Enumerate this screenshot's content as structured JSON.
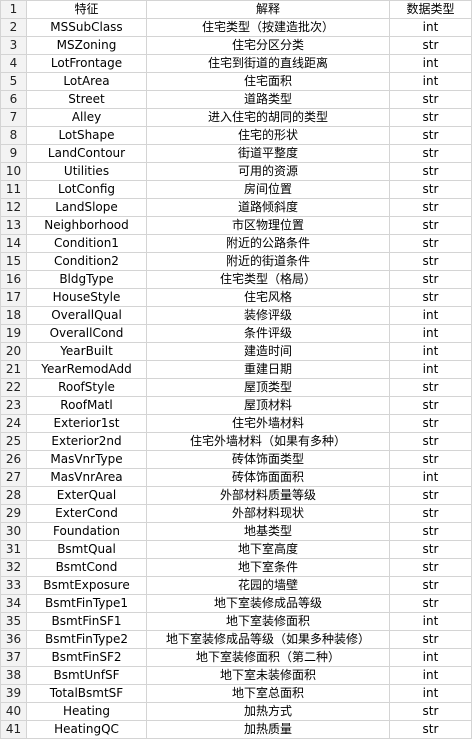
{
  "sheet": {
    "header": {
      "row": "1",
      "feature": "特征",
      "description": "解释",
      "type": "数据类型"
    },
    "rows": [
      {
        "row": "2",
        "feature": "MSSubClass",
        "description": "住宅类型（按建造批次）",
        "type": "int"
      },
      {
        "row": "3",
        "feature": "MSZoning",
        "description": "住宅分区分类",
        "type": "str"
      },
      {
        "row": "4",
        "feature": "LotFrontage",
        "description": "住宅到街道的直线距离",
        "type": "int"
      },
      {
        "row": "5",
        "feature": "LotArea",
        "description": "住宅面积",
        "type": "int"
      },
      {
        "row": "6",
        "feature": "Street",
        "description": "道路类型",
        "type": "str"
      },
      {
        "row": "7",
        "feature": "Alley",
        "description": "进入住宅的胡同的类型",
        "type": "str"
      },
      {
        "row": "8",
        "feature": "LotShape",
        "description": "住宅的形状",
        "type": "str"
      },
      {
        "row": "9",
        "feature": "LandContour",
        "description": "街道平整度",
        "type": "str"
      },
      {
        "row": "10",
        "feature": "Utilities",
        "description": "可用的资源",
        "type": "str"
      },
      {
        "row": "11",
        "feature": "LotConfig",
        "description": "房间位置",
        "type": "str"
      },
      {
        "row": "12",
        "feature": "LandSlope",
        "description": "道路倾斜度",
        "type": "str"
      },
      {
        "row": "13",
        "feature": "Neighborhood",
        "description": "市区物理位置",
        "type": "str"
      },
      {
        "row": "14",
        "feature": "Condition1",
        "description": "附近的公路条件",
        "type": "str"
      },
      {
        "row": "15",
        "feature": "Condition2",
        "description": "附近的街道条件",
        "type": "str"
      },
      {
        "row": "16",
        "feature": "BldgType",
        "description": "住宅类型（格局）",
        "type": "str"
      },
      {
        "row": "17",
        "feature": "HouseStyle",
        "description": "住宅风格",
        "type": "str"
      },
      {
        "row": "18",
        "feature": "OverallQual",
        "description": "装修评级",
        "type": "int"
      },
      {
        "row": "19",
        "feature": "OverallCond",
        "description": "条件评级",
        "type": "int"
      },
      {
        "row": "20",
        "feature": "YearBuilt",
        "description": "建造时间",
        "type": "int"
      },
      {
        "row": "21",
        "feature": "YearRemodAdd",
        "description": "重建日期",
        "type": "int"
      },
      {
        "row": "22",
        "feature": "RoofStyle",
        "description": "屋顶类型",
        "type": "str"
      },
      {
        "row": "23",
        "feature": "RoofMatl",
        "description": "屋顶材料",
        "type": "str"
      },
      {
        "row": "24",
        "feature": "Exterior1st",
        "description": "住宅外墙材料",
        "type": "str"
      },
      {
        "row": "25",
        "feature": "Exterior2nd",
        "description": "住宅外墙材料（如果有多种）",
        "type": "str"
      },
      {
        "row": "26",
        "feature": "MasVnrType",
        "description": "砖体饰面类型",
        "type": "str"
      },
      {
        "row": "27",
        "feature": "MasVnrArea",
        "description": "砖体饰面面积",
        "type": "int"
      },
      {
        "row": "28",
        "feature": "ExterQual",
        "description": "外部材料质量等级",
        "type": "str"
      },
      {
        "row": "29",
        "feature": "ExterCond",
        "description": "外部材料现状",
        "type": "str"
      },
      {
        "row": "30",
        "feature": "Foundation",
        "description": "地基类型",
        "type": "str"
      },
      {
        "row": "31",
        "feature": "BsmtQual",
        "description": "地下室高度",
        "type": "str"
      },
      {
        "row": "32",
        "feature": "BsmtCond",
        "description": "地下室条件",
        "type": "str"
      },
      {
        "row": "33",
        "feature": "BsmtExposure",
        "description": "花园的墙壁",
        "type": "str"
      },
      {
        "row": "34",
        "feature": "BsmtFinType1",
        "description": "地下室装修成品等级",
        "type": "str"
      },
      {
        "row": "35",
        "feature": "BsmtFinSF1",
        "description": "地下室装修面积",
        "type": "int"
      },
      {
        "row": "36",
        "feature": "BsmtFinType2",
        "description": "地下室装修成品等级（如果多种装修）",
        "type": "str"
      },
      {
        "row": "37",
        "feature": "BsmtFinSF2",
        "description": "地下室装修面积（第二种）",
        "type": "int"
      },
      {
        "row": "38",
        "feature": "BsmtUnfSF",
        "description": "地下室未装修面积",
        "type": "int"
      },
      {
        "row": "39",
        "feature": "TotalBsmtSF",
        "description": "地下室总面积",
        "type": "int"
      },
      {
        "row": "40",
        "feature": "Heating",
        "description": "加热方式",
        "type": "str"
      },
      {
        "row": "41",
        "feature": "HeatingQC",
        "description": "加热质量",
        "type": "str"
      }
    ]
  }
}
